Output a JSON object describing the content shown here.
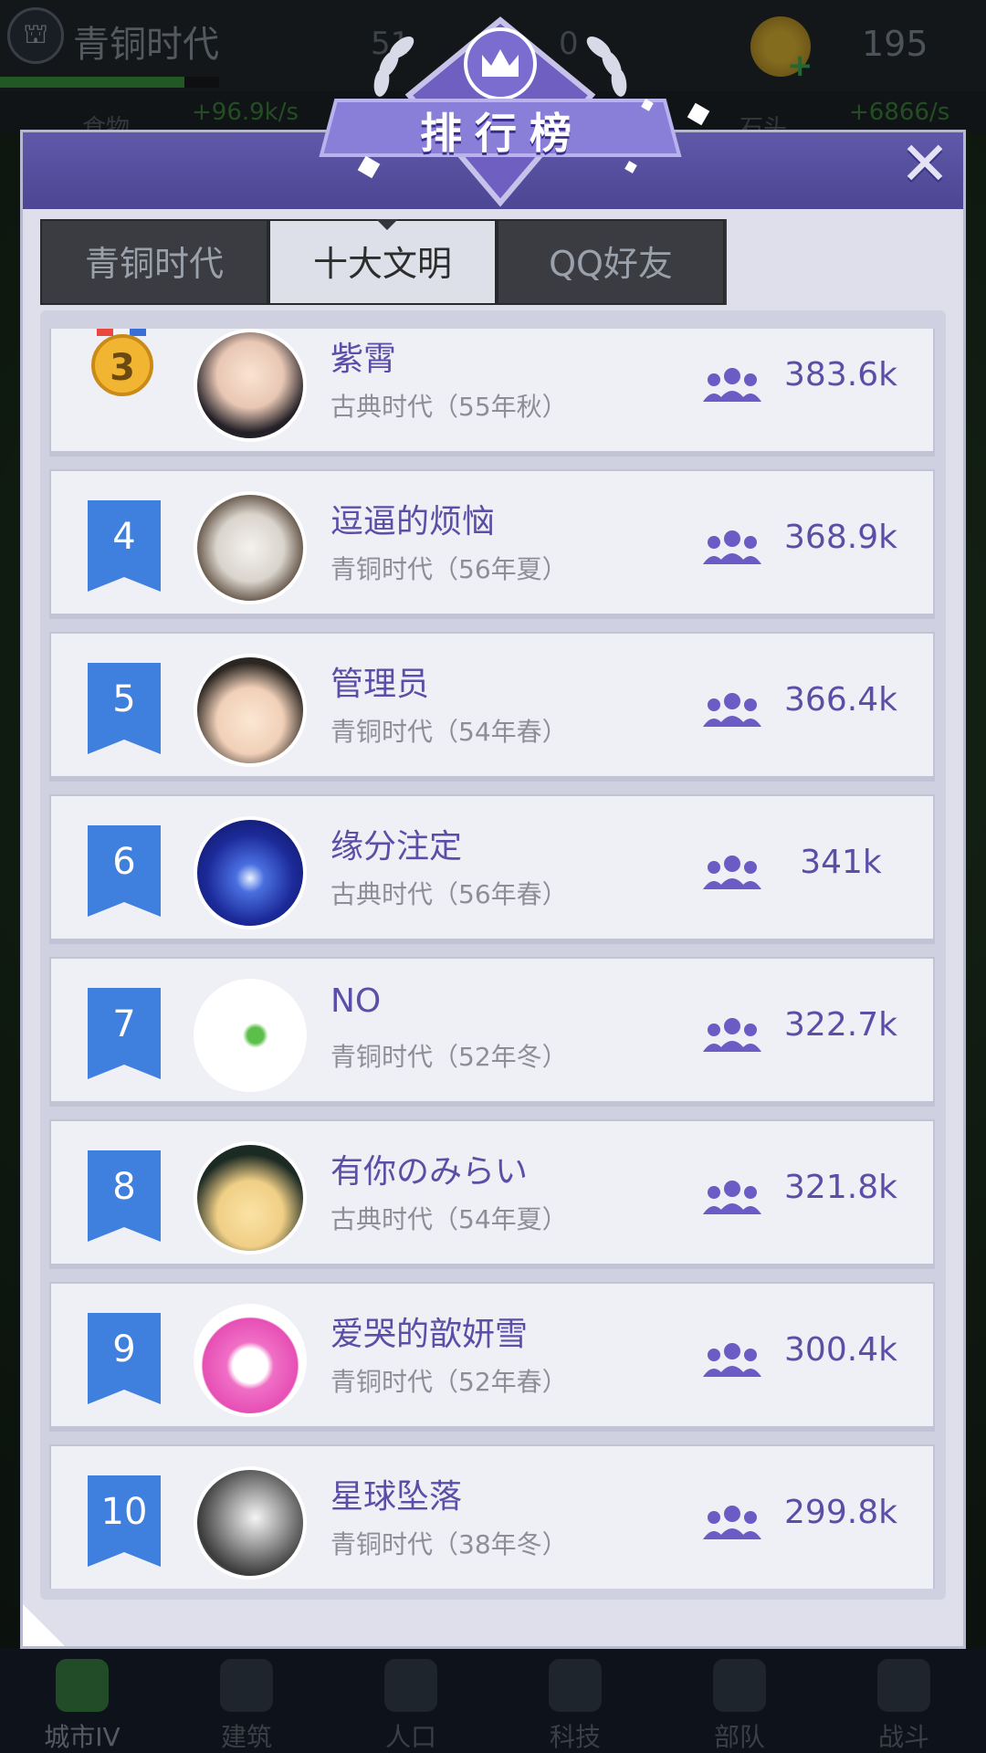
{
  "topbar": {
    "era_name": "青铜时代",
    "population": "51",
    "population2": "0",
    "coins": "195"
  },
  "resources": {
    "food_label": "食物",
    "food_rate": "+96.9k/s",
    "stone_label": "石头",
    "stone_rate": "+6866/s"
  },
  "modal": {
    "title": "排行榜",
    "close_icon": "✕"
  },
  "tabs": [
    {
      "label": "青铜时代",
      "active": false
    },
    {
      "label": "十大文明",
      "active": true
    },
    {
      "label": "QQ好友",
      "active": false
    }
  ],
  "rows": [
    {
      "rank": "3",
      "name": "紫霄",
      "era": "古典时代（55年秋）",
      "score": "383.6k"
    },
    {
      "rank": "4",
      "name": "逗逼的烦恼",
      "era": "青铜时代（56年夏）",
      "score": "368.9k"
    },
    {
      "rank": "5",
      "name": "管理员",
      "era": "青铜时代（54年春）",
      "score": "366.4k"
    },
    {
      "rank": "6",
      "name": "缘分注定",
      "era": "古典时代（56年春）",
      "score": "341k"
    },
    {
      "rank": "7",
      "name": "NO",
      "era": "青铜时代（52年冬）",
      "score": "322.7k"
    },
    {
      "rank": "8",
      "name": "有你のみらい",
      "era": "古典时代（54年夏）",
      "score": "321.8k"
    },
    {
      "rank": "9",
      "name": "爱哭的歆妍雪",
      "era": "青铜时代（52年春）",
      "score": "300.4k"
    },
    {
      "rank": "10",
      "name": "星球坠落",
      "era": "青铜时代（38年冬）",
      "score": "299.8k"
    }
  ],
  "nav": [
    {
      "label": "城市IV",
      "icon": "castle-icon"
    },
    {
      "label": "建筑",
      "icon": "house-icon"
    },
    {
      "label": "人口",
      "icon": "person-icon"
    },
    {
      "label": "科技",
      "icon": "book-icon"
    },
    {
      "label": "部队",
      "icon": "banner-icon"
    },
    {
      "label": "战斗",
      "icon": "swords-icon"
    }
  ],
  "colors": {
    "accent": "#5a4ea6",
    "rank_flag": "#3f7fde",
    "header": "#5650a2"
  }
}
